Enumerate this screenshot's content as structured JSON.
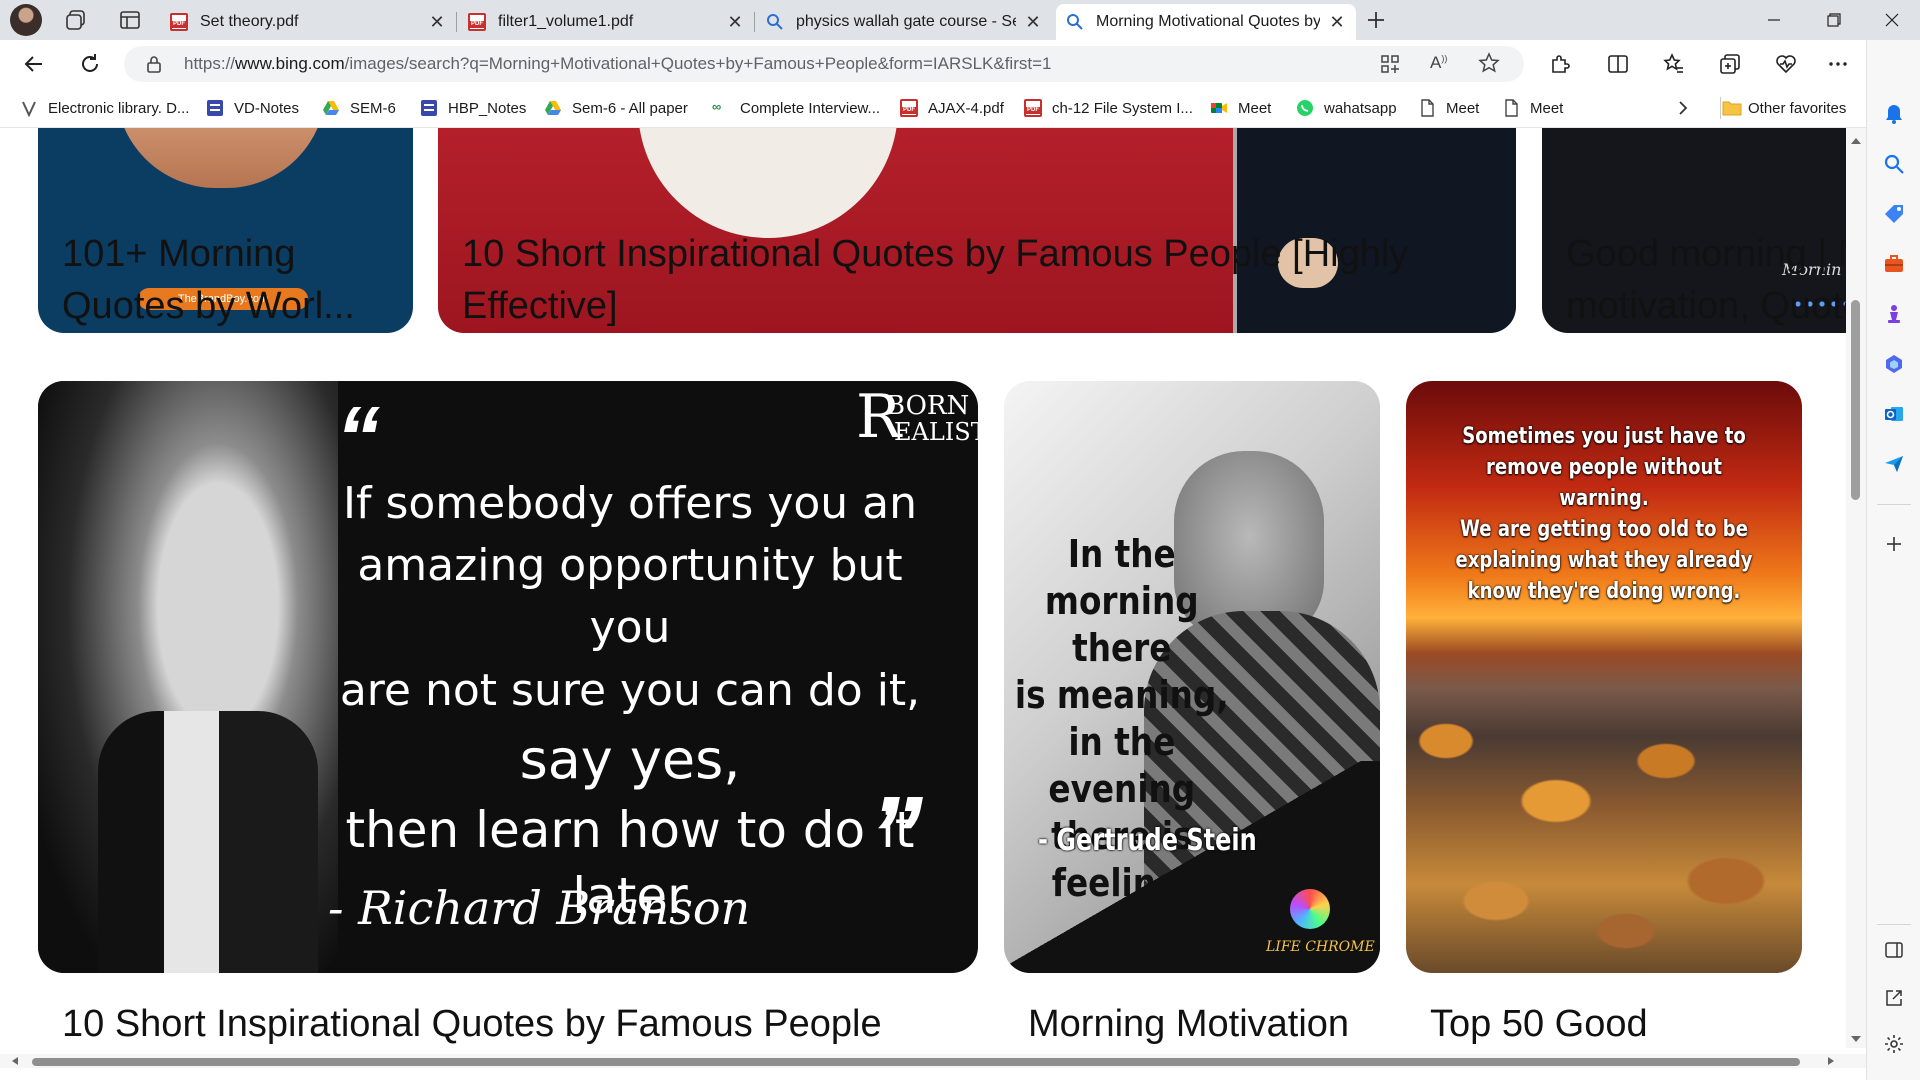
{
  "tabs": [
    {
      "title": "Set theory.pdf",
      "favicon": "pdf-icon"
    },
    {
      "title": "filter1_volume1.pdf",
      "favicon": "pdf-icon"
    },
    {
      "title": "physics wallah gate course - Sear",
      "favicon": "search-icon"
    },
    {
      "title": "Morning Motivational Quotes by",
      "favicon": "search-icon",
      "active": true
    }
  ],
  "address_bar": {
    "url_prefix": "https://",
    "url_host": "www.bing.com",
    "url_rest": "/images/search?q=Morning+Motivational+Quotes+by+Famous+People&form=IARSLK&first=1"
  },
  "favorites": [
    {
      "label": "Electronic library. D...",
      "icon": "v-icon"
    },
    {
      "label": "VD-Notes",
      "icon": "form-icon"
    },
    {
      "label": "SEM-6",
      "icon": "drive-icon"
    },
    {
      "label": "HBP_Notes",
      "icon": "form-icon"
    },
    {
      "label": "Sem-6 - All paper",
      "icon": "drive-icon"
    },
    {
      "label": "Complete Interview...",
      "icon": "gfg-icon"
    },
    {
      "label": "AJAX-4.pdf",
      "icon": "pdf-icon"
    },
    {
      "label": "ch-12 File System I...",
      "icon": "pdf-icon"
    },
    {
      "label": "Meet",
      "icon": "meet-icon"
    },
    {
      "label": "wahatsapp",
      "icon": "whatsapp-icon"
    },
    {
      "label": "Meet",
      "icon": "page-icon"
    },
    {
      "label": "Meet",
      "icon": "page-icon"
    }
  ],
  "other_favorites": "Other favorites",
  "results_row1": [
    {
      "caption_line1": "101+ Morning",
      "caption_line2": "Quotes by Worl...",
      "watermark": "TheBrandBoy.com"
    },
    {
      "caption_line1": "10 Short Inspirational Quotes by Famous People [Highly",
      "caption_line2": "Effective]"
    },
    {
      "caption_line1": "Good morning | M",
      "caption_line2": "motivation, Quote",
      "watermark": "Mornin"
    }
  ],
  "results_row2": [
    {
      "caption": "10 Short Inspirational Quotes by Famous People",
      "logo_line1": "BORN",
      "logo_line2": "EALIST",
      "logo_letter": "R",
      "quote_lines": [
        "If somebody offers you an",
        "amazing opportunity but you",
        "are not sure you can do it,",
        "say yes,",
        "then learn how to do it",
        "later"
      ],
      "author": "- Richard Branson"
    },
    {
      "caption": "Morning Motivation",
      "quote_lines": [
        "In the",
        "morning there",
        "is meaning,",
        "in the evening",
        "there is",
        "feeling."
      ],
      "author": "- Gertrude Stein",
      "brand": "LIFE CHROME"
    },
    {
      "caption": "Top 50 Good",
      "quote_lines": [
        "Sometimes you just have to",
        "remove people without warning.",
        "We are getting too old to be",
        "explaining what they already",
        "know they're doing wrong."
      ]
    }
  ]
}
